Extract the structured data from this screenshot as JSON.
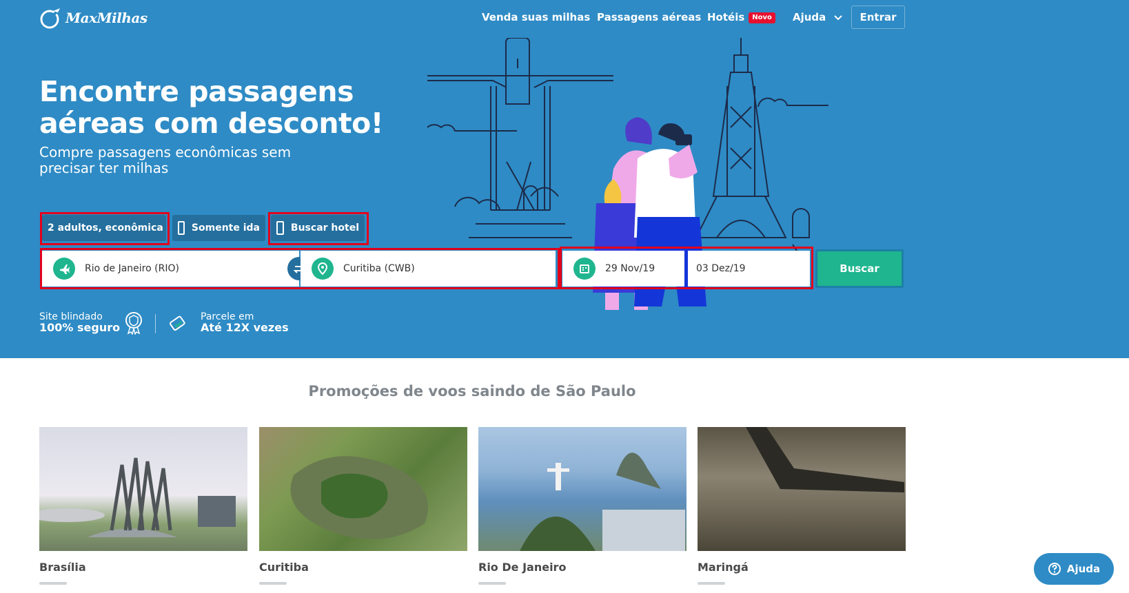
{
  "brand": {
    "name": "MaxMilhas"
  },
  "nav": {
    "items": [
      {
        "label": "Venda suas milhas"
      },
      {
        "label": "Passagens aéreas"
      },
      {
        "label": "Hotéis",
        "badge": "Novo"
      },
      {
        "label": "Ajuda"
      }
    ],
    "login_label": "Entrar"
  },
  "hero": {
    "title": "Encontre passagens aéreas com desconto!",
    "subtitle": "Compre passagens econômicas sem precisar ter milhas"
  },
  "search": {
    "passengers": "2 adultos, econômica",
    "one_way_label": "Somente ida",
    "hotel_label": "Buscar hotel",
    "origin": "Rio de Janeiro (RIO)",
    "destination": "Curitiba (CWB)",
    "departure_date": "29 Nov/19",
    "return_date": "03 Dez/19",
    "submit_label": "Buscar"
  },
  "trust": {
    "security_line1": "Site blindado",
    "security_line2": "100% seguro",
    "installments_line1": "Parcele em",
    "installments_line2": "Até 12X vezes"
  },
  "promos": {
    "title": "Promoções de voos saindo de São Paulo",
    "cards": [
      {
        "city": "Brasília"
      },
      {
        "city": "Curitiba"
      },
      {
        "city": "Rio De Janeiro"
      },
      {
        "city": "Maringá"
      }
    ]
  },
  "help_button": {
    "label": "Ajuda"
  },
  "colors": {
    "hero_bg": "#2e8bc5",
    "accent_green": "#1fb58f",
    "badge_red": "#e8102e",
    "highlight_red": "#e3001b"
  }
}
